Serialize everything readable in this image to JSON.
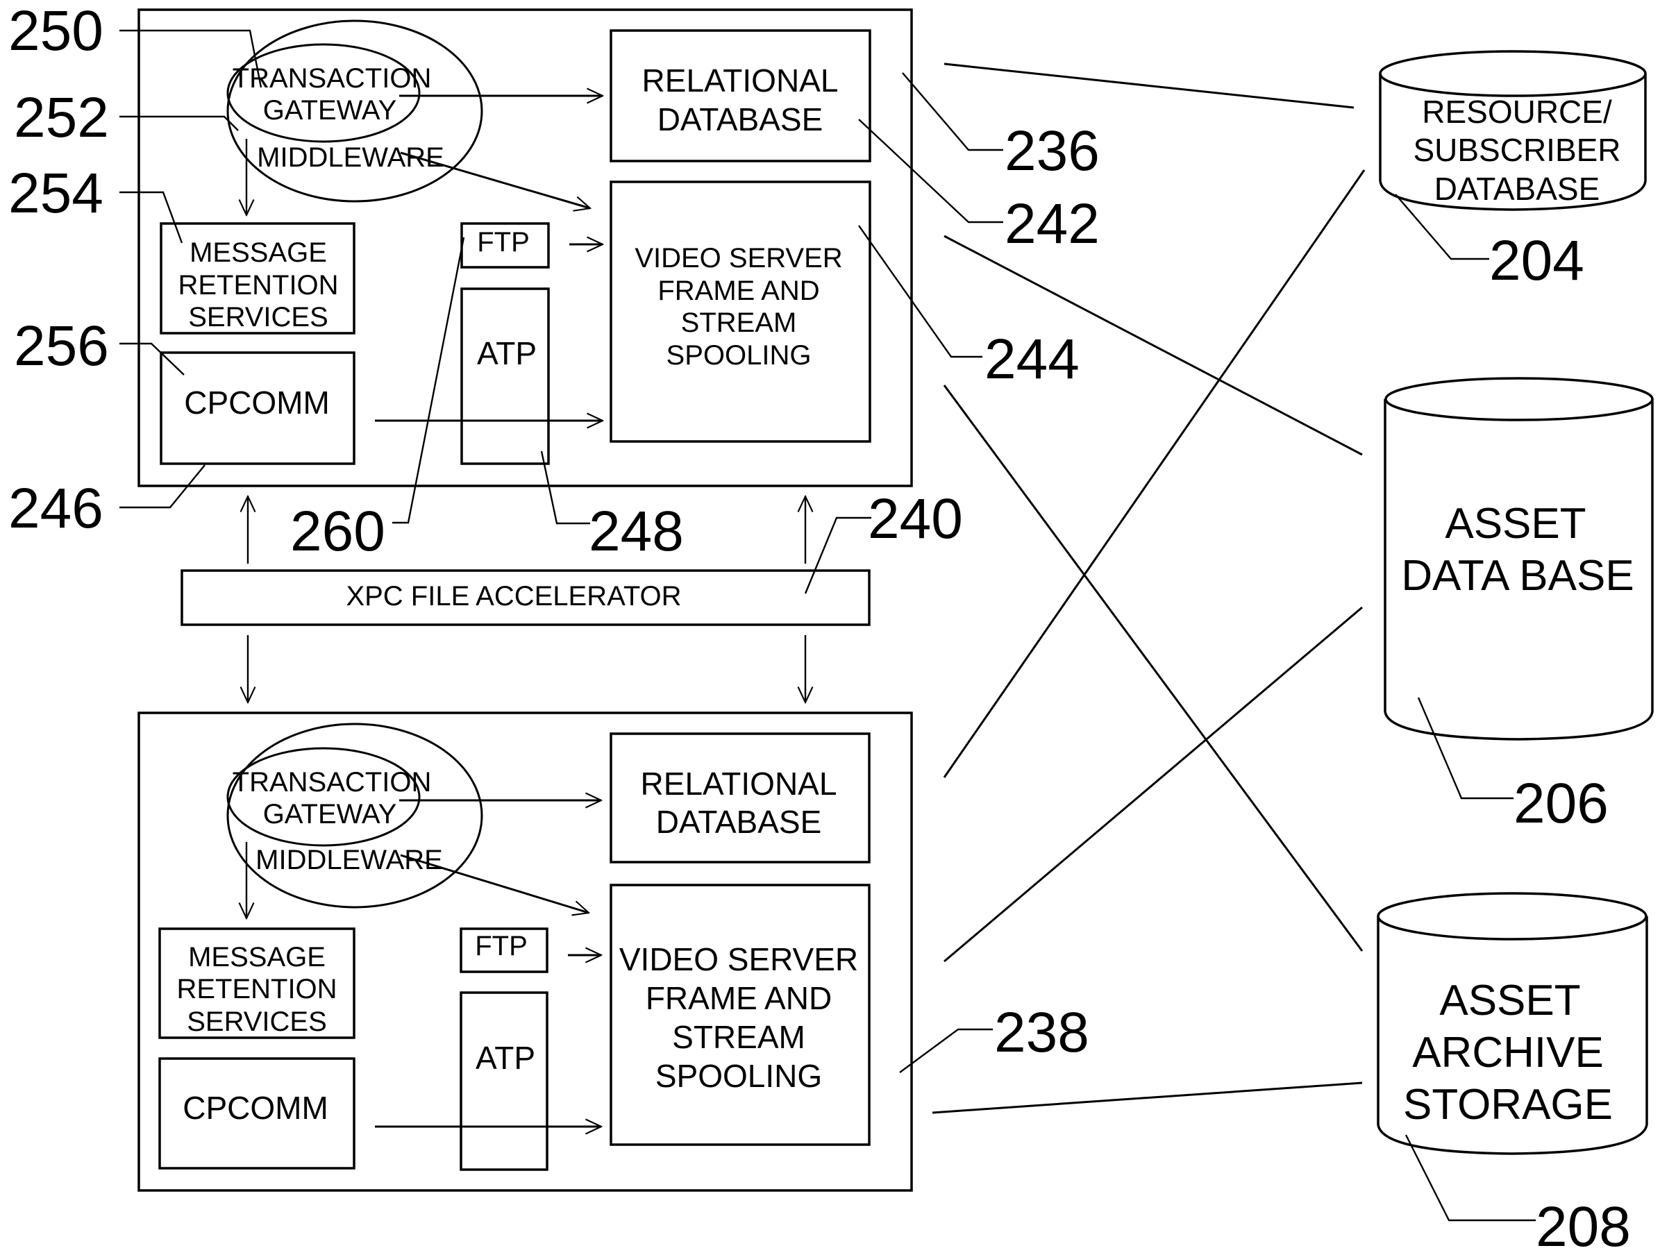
{
  "figure": {
    "type": "patent-block-diagram",
    "colors": {
      "line": "#000000",
      "background": "#ffffff"
    }
  },
  "top_system": {
    "middleware_label": "MIDDLEWARE",
    "gateway_line1": "TRANSACTION",
    "gateway_line2": "GATEWAY",
    "relational_db_line1": "RELATIONAL",
    "relational_db_line2": "DATABASE",
    "video_server_lines": [
      "VIDEO SERVER",
      "FRAME AND",
      "STREAM",
      "SPOOLING"
    ],
    "mrs_lines": [
      "MESSAGE",
      "RETENTION",
      "SERVICES"
    ],
    "cpcomm": "CPCOMM",
    "ftp": "FTP",
    "atp": "ATP"
  },
  "accelerator": {
    "label": "XPC FILE ACCELERATOR"
  },
  "bottom_system": {
    "middleware_label": "MIDDLEWARE",
    "gateway_line1": "TRANSACTION",
    "gateway_line2": "GATEWAY",
    "relational_db_line1": "RELATIONAL",
    "relational_db_line2": "DATABASE",
    "video_server_lines": [
      "VIDEO SERVER",
      "FRAME AND",
      "STREAM",
      "SPOOLING"
    ],
    "mrs_lines": [
      "MESSAGE",
      "RETENTION",
      "SERVICES"
    ],
    "cpcomm": "CPCOMM",
    "ftp": "FTP",
    "atp": "ATP"
  },
  "databases": {
    "resource_lines": [
      "RESOURCE/",
      "SUBSCRIBER",
      "DATABASE"
    ],
    "asset_lines": [
      "ASSET",
      "DATA BASE"
    ],
    "archive_lines": [
      "ASSET",
      "ARCHIVE",
      "STORAGE"
    ]
  },
  "reference_numerals": {
    "r250": "250",
    "r252": "252",
    "r254": "254",
    "r256": "256",
    "r246": "246",
    "r260": "260",
    "r248": "248",
    "r240": "240",
    "r236": "236",
    "r242": "242",
    "r244": "244",
    "r238": "238",
    "r204": "204",
    "r206": "206",
    "r208": "208"
  }
}
